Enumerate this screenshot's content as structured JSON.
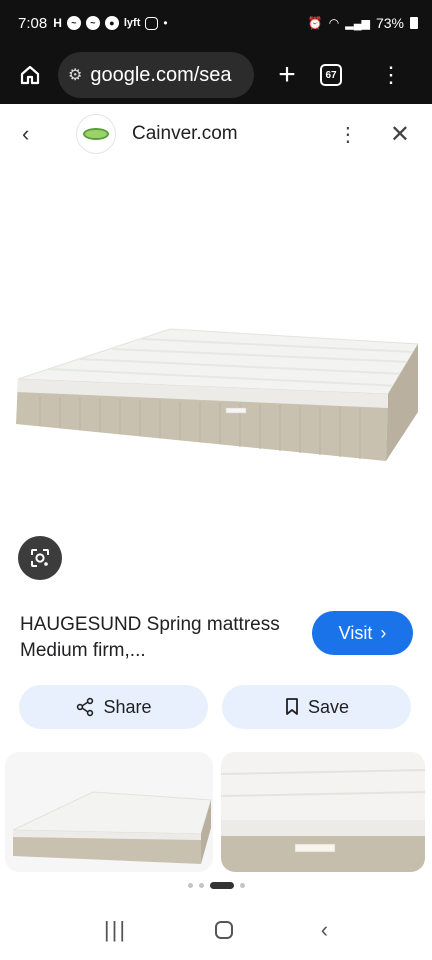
{
  "status_bar": {
    "time": "7:08",
    "battery": "73%",
    "notif_icons": [
      "h-icon",
      "messenger-icon",
      "messenger-icon",
      "account-icon",
      "lyft-icon",
      "instagram-icon",
      "dot-icon"
    ],
    "lyft": "lyft"
  },
  "browser": {
    "url": "google.com/sea",
    "tab_count": "67"
  },
  "sheet": {
    "site_name": "Cainver.com"
  },
  "product": {
    "title": "HAUGESUND Spring mattress Medium firm,...",
    "visit_label": "Visit",
    "share_label": "Share",
    "save_label": "Save"
  },
  "colors": {
    "accent": "#1a73e8",
    "pill_bg": "#e8f0fe",
    "chrome_bg": "#111111"
  },
  "carousel": {
    "active_index": 2,
    "count": 4
  }
}
